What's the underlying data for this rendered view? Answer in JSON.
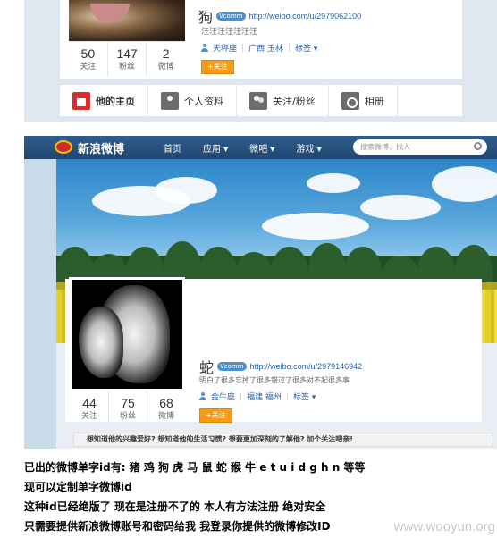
{
  "shot1": {
    "profile": {
      "name": "狗",
      "badge": "Vcomm",
      "url": "http://weibo.com/u/2979062100",
      "bio": "汪汪汪汪汪汪汪"
    },
    "stats": [
      {
        "num": "50",
        "label": "关注"
      },
      {
        "num": "147",
        "label": "粉丝"
      },
      {
        "num": "2",
        "label": "微博"
      }
    ],
    "tags": {
      "astro": "天秤座",
      "location": "广西 玉林",
      "tag": "标签"
    },
    "follow_label": "+关注",
    "tabs": [
      {
        "label": "他的主页",
        "icon": "home-icon"
      },
      {
        "label": "个人资料",
        "icon": "profile-icon"
      },
      {
        "label": "关注/粉丝",
        "icon": "follow-icon"
      },
      {
        "label": "相册",
        "icon": "photo-icon"
      }
    ]
  },
  "shot2": {
    "logo_text": "新浪微博",
    "nav": [
      "首页",
      "应用 ▾",
      "微吧 ▾",
      "游戏 ▾"
    ],
    "search_placeholder": "搜索微博、找人",
    "profile": {
      "name": "蛇",
      "badge": "Vcomm",
      "url": "http://weibo.com/u/2979146942",
      "bio": "明白了很多忘掉了很多错过了很多对不起很多事"
    },
    "stats": [
      {
        "num": "44",
        "label": "关注"
      },
      {
        "num": "75",
        "label": "粉丝"
      },
      {
        "num": "68",
        "label": "微博"
      }
    ],
    "tags": {
      "astro": "金牛座",
      "location": "福建 福州",
      "tag": "标签"
    },
    "follow_label": "+关注",
    "notice": "想知道他的兴趣爱好? 想知道他的生活习惯? 想要更加深刻的了解他? 加个关注吧亲!"
  },
  "caption": [
    "已出的微博单字id有: 猪 鸡 狗 虎 马 鼠 蛇 猴 牛 e t u i d g h n 等等",
    "现可以定制单字微博id",
    "这种id已经绝版了 现在是注册不了的 本人有方法注册 绝对安全",
    "只需要提供新浪微博账号和密码给我 我登录你提供的微博修改ID"
  ],
  "watermark": "www.wooyun.org"
}
